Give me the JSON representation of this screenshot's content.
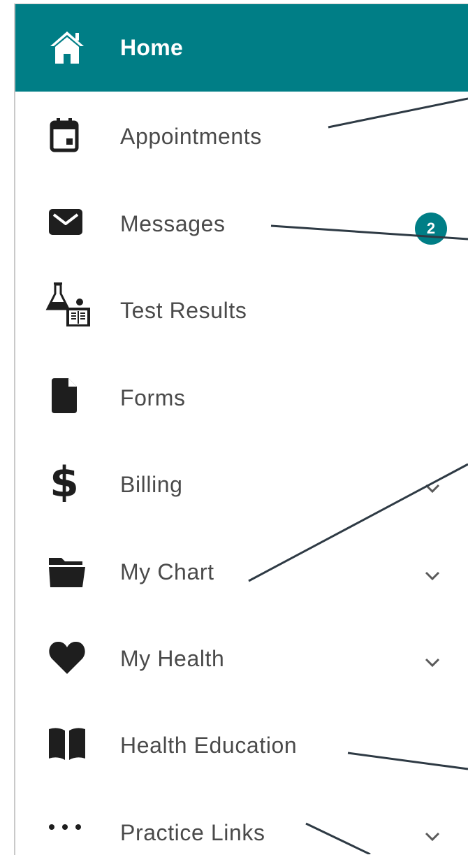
{
  "nav": {
    "items": [
      {
        "label": "Home"
      },
      {
        "label": "Appointments"
      },
      {
        "label": "Messages",
        "badge": "2"
      },
      {
        "label": "Test Results"
      },
      {
        "label": "Forms"
      },
      {
        "label": "Billing"
      },
      {
        "label": "My Chart"
      },
      {
        "label": "My Health"
      },
      {
        "label": "Health Education"
      },
      {
        "label": "Practice Links"
      }
    ]
  },
  "colors": {
    "accent": "#007e86",
    "text": "#4a4a4a",
    "icon": "#1e1e1e",
    "callout_line": "#2e3a44"
  }
}
